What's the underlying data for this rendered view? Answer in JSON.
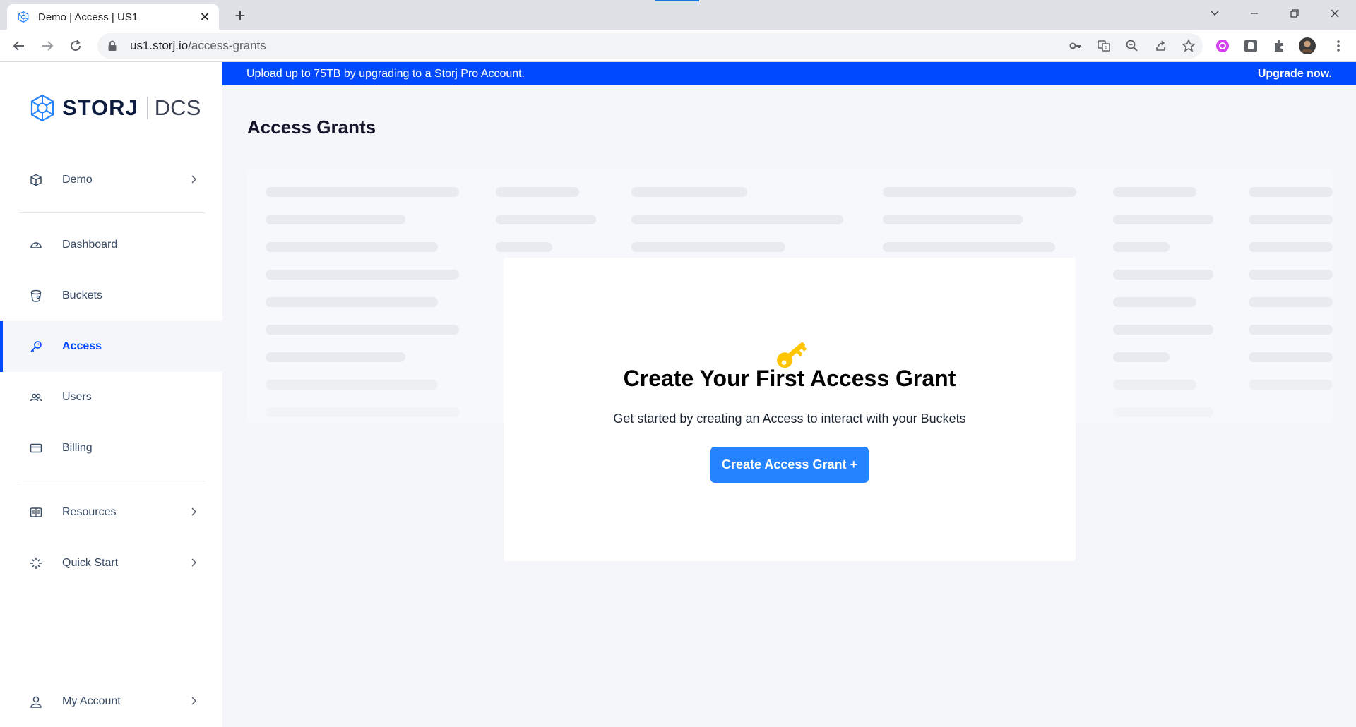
{
  "browser": {
    "tab_title": "Demo | Access | US1",
    "url_host": "us1.storj.io",
    "url_path": "/access-grants"
  },
  "banner": {
    "message": "Upload up to 75TB by upgrading to a Storj Pro Account.",
    "cta": "Upgrade now."
  },
  "logo": {
    "brand": "STORJ",
    "product": "DCS"
  },
  "sidebar": {
    "project": {
      "label": "Demo",
      "icon": "cube-icon"
    },
    "items": [
      {
        "label": "Dashboard",
        "icon": "gauge-icon"
      },
      {
        "label": "Buckets",
        "icon": "bucket-icon"
      },
      {
        "label": "Access",
        "icon": "key-icon",
        "active": true
      },
      {
        "label": "Users",
        "icon": "users-icon"
      },
      {
        "label": "Billing",
        "icon": "card-icon"
      }
    ],
    "resources": {
      "label": "Resources",
      "icon": "book-icon"
    },
    "quick_start": {
      "label": "Quick Start",
      "icon": "spark-icon"
    },
    "account": {
      "label": "My Account",
      "icon": "user-icon"
    }
  },
  "page": {
    "title": "Access Grants"
  },
  "empty_state": {
    "heading": "Create Your First Access Grant",
    "description": "Get started by creating an Access to interact with your Buckets",
    "button": "Create Access Grant +"
  },
  "colors": {
    "accent": "#0149ff",
    "button": "#2683ff",
    "key": "#ffc600"
  }
}
